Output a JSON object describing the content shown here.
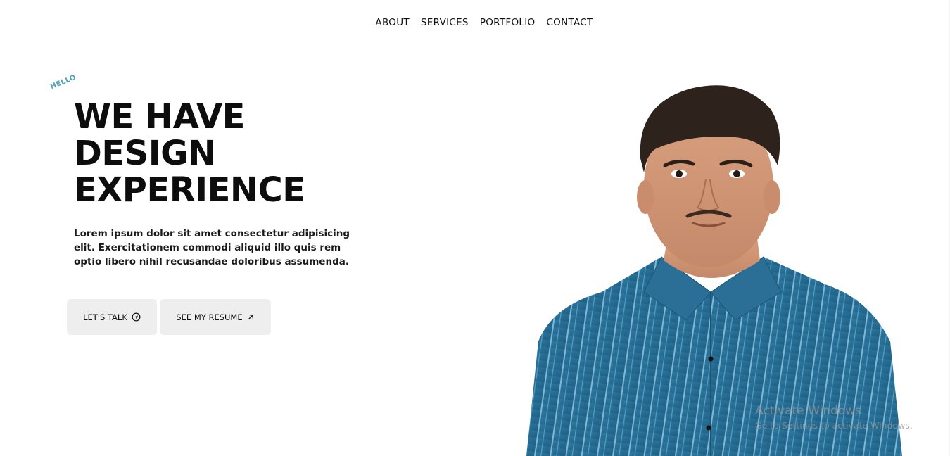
{
  "nav": {
    "items": [
      "ABOUT",
      "SERVICES",
      "PORTFOLIO",
      "CONTACT"
    ]
  },
  "hero": {
    "tag": "HELLO",
    "headline": [
      "WE HAVE",
      "DESIGN",
      "EXPERIENCE"
    ],
    "description": "Lorem ipsum dolor sit amet consectetur adipisicing elit. Exercitationem commodi aliquid illo quis rem optio libero nihil recusandae doloribus assumenda.",
    "buttons": {
      "talk_label": "LET'S TALK",
      "talk_icon": "send-circle-icon",
      "resume_label": "SEE MY RESUME",
      "resume_icon": "arrow-up-right-icon"
    },
    "portrait_alt": "portrait-photo"
  },
  "colors": {
    "accent": "#4aa3b4",
    "button_bg": "#eeeeee",
    "shirt": "#2a6d94"
  },
  "watermark": {
    "title": "Activate Windows",
    "subtitle": "Go to Settings to activate Windows."
  }
}
